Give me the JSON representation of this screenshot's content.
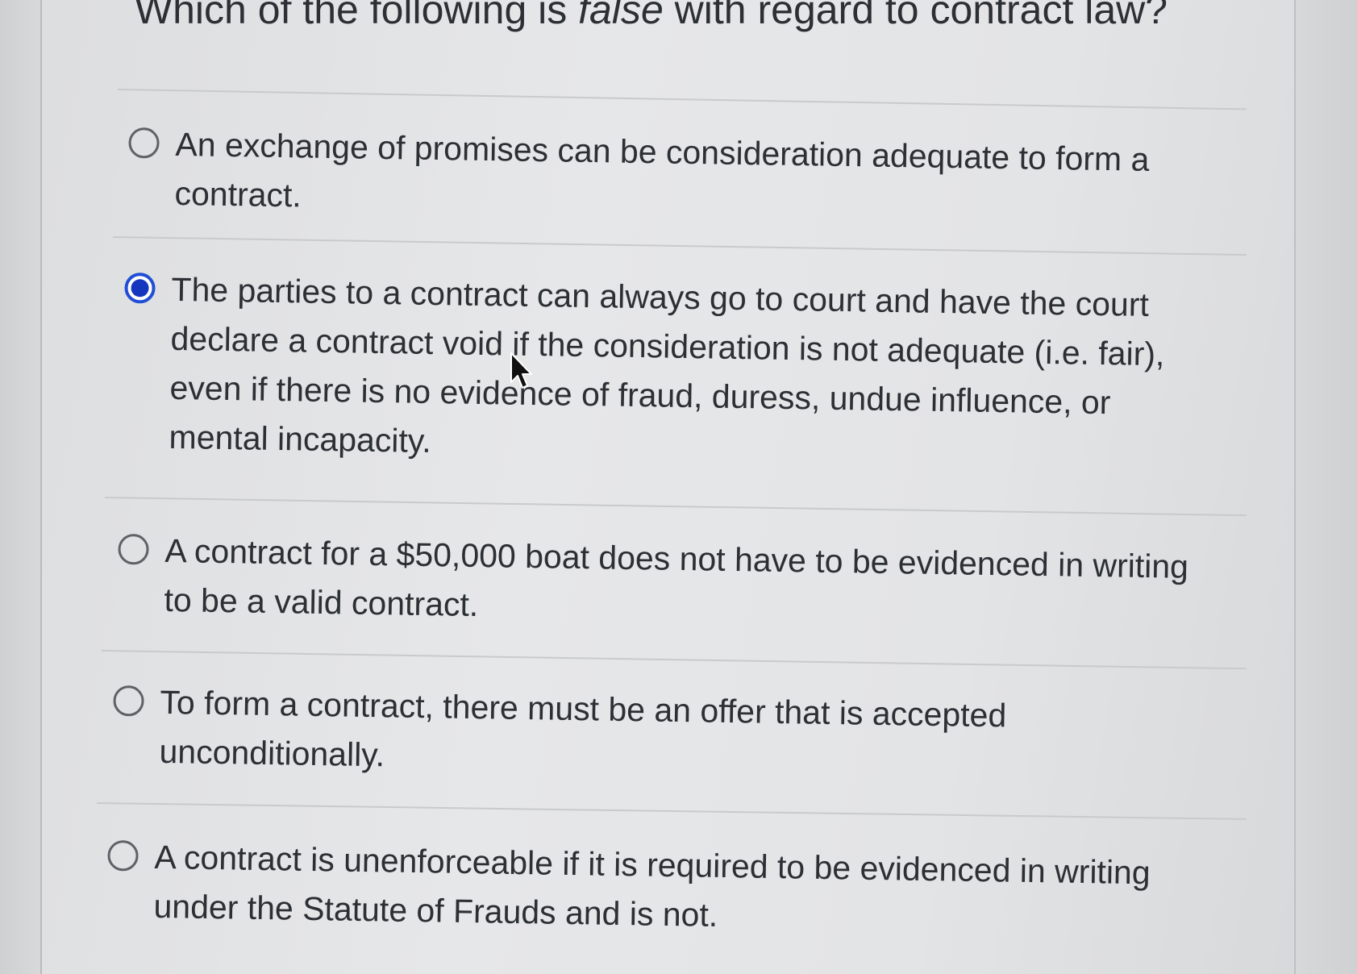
{
  "question": {
    "prefix": "Which of the following is ",
    "emphasis": "false",
    "suffix": " with regard to contract law?"
  },
  "options": [
    {
      "label": "An exchange of promises can be consideration adequate to form a contract.",
      "selected": false
    },
    {
      "label": "The parties to a contract can always go to court and have the court declare a contract void if the consideration is not adequate (i.e. fair), even if there is no evidence of fraud, duress, undue influence, or mental incapacity.",
      "selected": true
    },
    {
      "label": "A contract for a $50,000 boat does not have to be evidenced in writing to be a valid contract.",
      "selected": false
    },
    {
      "label": "To form a contract, there must be an offer that is accepted unconditionally.",
      "selected": false
    },
    {
      "label": "A contract is unenforceable if it is required to be evidenced in writing under the Statute of Frauds and is not.",
      "selected": false
    }
  ],
  "colors": {
    "selected_radio": "#1f4fd6",
    "text": "#2c2f33",
    "divider": "#c9cacc"
  }
}
